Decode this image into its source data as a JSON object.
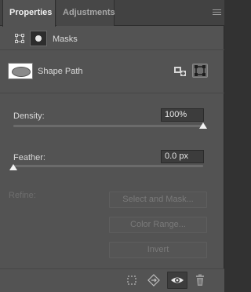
{
  "tabs": [
    {
      "label": "Properties",
      "active": true
    },
    {
      "label": "Adjustments",
      "active": false
    }
  ],
  "masks_row": {
    "label": "Masks"
  },
  "shape_row": {
    "label": "Shape Path"
  },
  "density": {
    "label": "Density:",
    "value": "100%",
    "percent": 100
  },
  "feather": {
    "label": "Feather:",
    "value": "0.0 px",
    "percent": 0
  },
  "refine": {
    "label": "Refine:",
    "buttons": [
      "Select and Mask...",
      "Color Range...",
      "Invert"
    ]
  },
  "colors": {
    "panel": "#535353",
    "tabbar": "#424242",
    "field": "#3c3c3c"
  },
  "icons": [
    "panel-menu-icon",
    "pixel-mask-icon",
    "vector-mask-icon",
    "load-selection-icon",
    "vector-mask-select-icon",
    "dotted-selection-icon",
    "apply-mask-icon",
    "eye-icon",
    "trash-icon"
  ]
}
